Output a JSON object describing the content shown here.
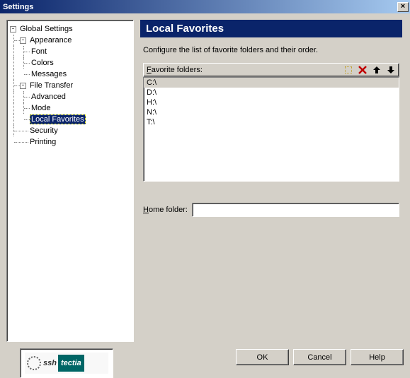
{
  "window": {
    "title": "Settings"
  },
  "tree": {
    "root": "Global Settings",
    "appearance": {
      "label": "Appearance",
      "children": [
        "Font",
        "Colors",
        "Messages"
      ]
    },
    "file_transfer": {
      "label": "File Transfer",
      "children": [
        "Advanced",
        "Mode",
        "Local Favorites"
      ]
    },
    "security": "Security",
    "printing": "Printing",
    "selected": "Local Favorites"
  },
  "content": {
    "heading": "Local Favorites",
    "description": "Configure the list of favorite folders and their order.",
    "favorites_label": "Favorite folders:",
    "favorites": [
      "C:\\",
      "D:\\",
      "H:\\",
      "N:\\",
      "T:\\"
    ],
    "selected_favorite": "C:\\",
    "home_label": "Home folder:",
    "home_value": ""
  },
  "icons": {
    "add": "add-folder-icon",
    "delete": "delete-icon",
    "up": "move-up-icon",
    "down": "move-down-icon"
  },
  "logo": {
    "part1": "ssh",
    "part2": "tectia"
  },
  "buttons": {
    "ok": "OK",
    "cancel": "Cancel",
    "help": "Help"
  }
}
